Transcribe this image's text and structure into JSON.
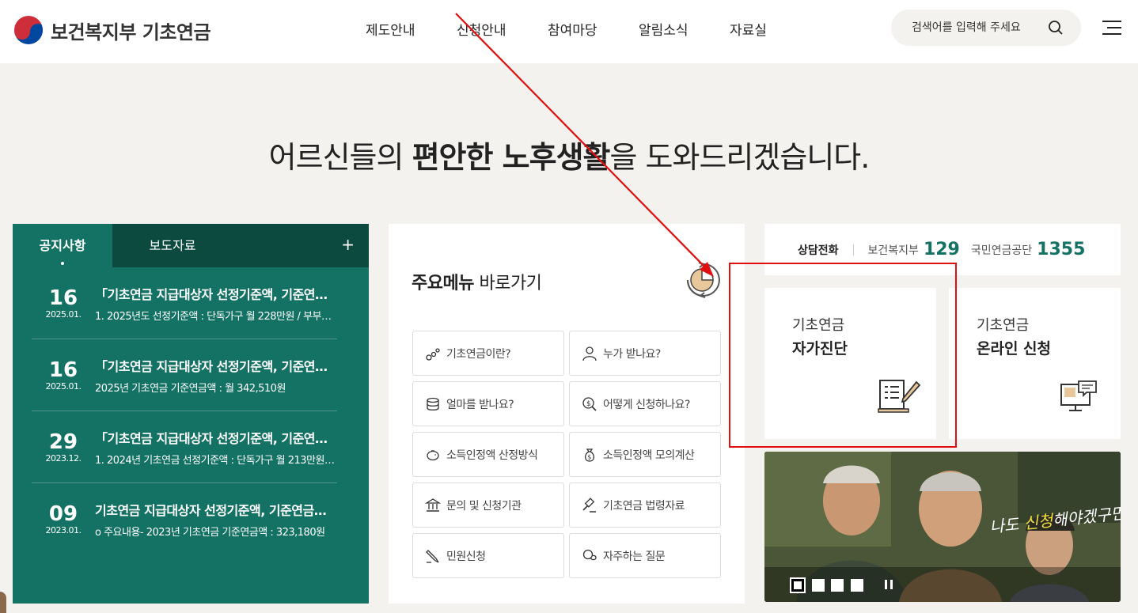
{
  "header": {
    "logo_text": "보건복지부 기초연금",
    "nav": [
      "제도안내",
      "신청안내",
      "참여마당",
      "알림소식",
      "자료실"
    ],
    "search_placeholder": "검색어를 입력해 주세요"
  },
  "hero": {
    "prefix": "어르신들의 ",
    "bold": "편안한 노후생활",
    "suffix": "을 도와드리겠습니다."
  },
  "notice": {
    "tabs": [
      "공지사항",
      "보도자료"
    ],
    "more": "+",
    "items": [
      {
        "day": "16",
        "ym": "2025.01.",
        "title": "「기초연금 지급대상자 선정기준액, 기준연금…",
        "desc": "1. 2025년도 선정기준액 : 단독가구 월 228만원 / 부부…"
      },
      {
        "day": "16",
        "ym": "2025.01.",
        "title": "「기초연금 지급대상자 선정기준액, 기준연금…",
        "desc": "2025년 기초연금 기준연금액 : 월 342,510원"
      },
      {
        "day": "29",
        "ym": "2023.12.",
        "title": "「기초연금 지급대상자 선정기준액, 기준연금…",
        "desc": "1. 2024년 기초연금 선정기준액 : 단독가구 월 213만원 /…"
      },
      {
        "day": "09",
        "ym": "2023.01.",
        "title": "기초연금 지급대상자 선정기준액, 기준연금액…",
        "desc": "o 주요내용- 2023년 기초연금 기준연금액 : 323,180원"
      }
    ]
  },
  "quick": {
    "title_bold": "주요메뉴",
    "title_rest": " 바로가기",
    "buttons": [
      {
        "label": "기초연금이란?",
        "icon": "coins-growth-icon"
      },
      {
        "label": "누가 받나요?",
        "icon": "person-icon"
      },
      {
        "label": "얼마를 받나요?",
        "icon": "coin-stack-icon"
      },
      {
        "label": "어떻게 신청하나요?",
        "icon": "magnifier-dollar-icon"
      },
      {
        "label": "소득인정액 산정방식",
        "icon": "piggy-bank-icon"
      },
      {
        "label": "소득인정액 모의계산",
        "icon": "money-bag-icon"
      },
      {
        "label": "문의 및 신청기관",
        "icon": "bank-icon"
      },
      {
        "label": "기초연금 법령자료",
        "icon": "gavel-icon"
      },
      {
        "label": "민원신청",
        "icon": "pen-icon"
      },
      {
        "label": "자주하는 질문",
        "icon": "chat-bubbles-icon"
      }
    ]
  },
  "hotline": {
    "label": "상담전화",
    "org1": "보건복지부",
    "num1": "129",
    "org2": "국민연금공단",
    "num2": "1355"
  },
  "cards": [
    {
      "line1": "기초연금",
      "line2": "자가진단",
      "icon": "checklist-pen-icon"
    },
    {
      "line1": "기초연금",
      "line2": "온라인 신청",
      "icon": "monitor-chat-icon"
    }
  ],
  "banner": {
    "text_a": "나도 ",
    "text_b": "신청",
    "text_c": "해야겠구먼!",
    "slides": 4,
    "active_slide": 1
  },
  "colors": {
    "brand_green": "#147264",
    "dark_green": "#0c4a3f",
    "page_bg": "#f4f2ee",
    "annotation_red": "#e01010"
  }
}
